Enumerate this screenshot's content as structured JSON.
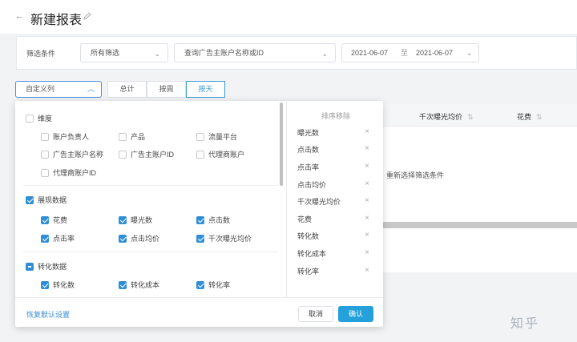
{
  "header": {
    "title": "新建报表",
    "back_icon": "arrow-left-icon",
    "edit_icon": "pencil-icon"
  },
  "filters": {
    "label": "筛选条件",
    "filter_select": "所有筛选",
    "account_search_placeholder": "查询广告主账户名称或ID",
    "date_start": "2021-06-07",
    "date_sep": "至",
    "date_end": "2021-06-07"
  },
  "toolbar": {
    "custom_columns": "自定义列",
    "segments": [
      {
        "label": "总计",
        "active": false
      },
      {
        "label": "按周",
        "active": false
      },
      {
        "label": "按天",
        "active": true
      }
    ]
  },
  "table": {
    "headers": [
      {
        "label": "千次曝光均价"
      },
      {
        "label": "花费"
      }
    ],
    "empty_hint": "重新选择筛选条件"
  },
  "column_picker": {
    "groups": [
      {
        "label": "维度",
        "state": "unchecked",
        "items": [
          {
            "label": "账户负责人",
            "checked": false
          },
          {
            "label": "产品",
            "checked": false
          },
          {
            "label": "流量平台",
            "checked": false
          },
          {
            "label": "广告主账户名称",
            "checked": false
          },
          {
            "label": "广告主账户ID",
            "checked": false
          },
          {
            "label": "代理商账户",
            "checked": false
          },
          {
            "label": "代理商账户ID",
            "checked": false
          }
        ]
      },
      {
        "label": "展现数据",
        "state": "checked",
        "items": [
          {
            "label": "花费",
            "checked": true
          },
          {
            "label": "曝光数",
            "checked": true
          },
          {
            "label": "点击数",
            "checked": true
          },
          {
            "label": "点击率",
            "checked": true
          },
          {
            "label": "点击均价",
            "checked": true
          },
          {
            "label": "千次曝光均价",
            "checked": true
          }
        ]
      },
      {
        "label": "转化数据",
        "state": "partial",
        "items": [
          {
            "label": "转化数",
            "checked": true
          },
          {
            "label": "转化成本",
            "checked": true
          },
          {
            "label": "转化率",
            "checked": true
          }
        ]
      }
    ],
    "sort_title": "排序移除",
    "selected": [
      "曝光数",
      "点击数",
      "点击率",
      "点击均价",
      "千次曝光均价",
      "花费",
      "转化数",
      "转化成本",
      "转化率"
    ],
    "reset_label": "恢复默认设置",
    "cancel_label": "取消",
    "confirm_label": "确认"
  },
  "watermark": "知乎",
  "colors": {
    "primary": "#2f8fd6",
    "confirm": "#24a0db",
    "page_bg": "#f2f3f5"
  }
}
